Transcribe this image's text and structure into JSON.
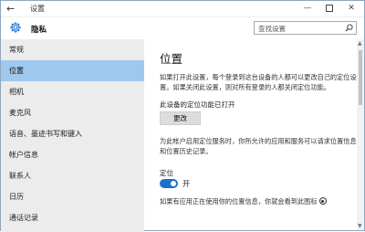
{
  "window": {
    "title": "设置",
    "back_glyph": "←",
    "minimize_glyph": "—",
    "close_glyph": "✕"
  },
  "header": {
    "section_title": "隐私",
    "search_placeholder": "查找设置"
  },
  "sidebar": {
    "items": [
      {
        "label": "常规"
      },
      {
        "label": "位置"
      },
      {
        "label": "相机"
      },
      {
        "label": "麦克风"
      },
      {
        "label": "语音、墨迹书写和键入"
      },
      {
        "label": "帐户信息"
      },
      {
        "label": "联系人"
      },
      {
        "label": "日历"
      },
      {
        "label": "通话记录"
      }
    ],
    "selected_index": 1
  },
  "content": {
    "title": "位置",
    "description_1": "如果打开此设置，每个登录到这台设备的人都可以更改自己的定位设置。如果关闭此设置，则对所有登录的人都关闭定位功能。",
    "device_status": "此设备的定位功能已打开",
    "change_button": "更改",
    "description_2": "为此帐户启用定位服务时，你所允许的应用和服务可以请求位置信息和位置历史记录。",
    "location_label": "定位",
    "toggle_state_label": "开",
    "description_3": "如果有应用正在使用你的位置信息，你就会看到此图标"
  },
  "colors": {
    "accent": "#1a73c8",
    "selected_nav": "#9fc8ee",
    "sidebar_bg": "#ececec"
  },
  "icons": {
    "back": "back-arrow-icon",
    "settings": "gear-icon",
    "search": "search-icon",
    "location_in_use": "location-in-use-icon"
  }
}
